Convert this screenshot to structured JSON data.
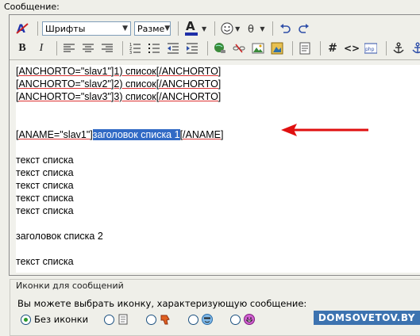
{
  "section_title": "Сообщение:",
  "toolbar": {
    "font_combo": "Шрифты",
    "size_combo": "Разме",
    "text_color_letter": "A",
    "bold_letter": "B",
    "italic_letter": "I"
  },
  "editor_lines": {
    "l1": "[ANCHORTO=\"slav1\"]1) список[/ANCHORTO]",
    "l2": "[ANCHORTO=\"slav2\"]2) список[/ANCHORTO]",
    "l3": "[ANCHORTO=\"slav3\"]3) список[/ANCHORTO]",
    "aname_open": "[ANAME=\"slav1\"]",
    "aname_selected": "заголовок списка 1",
    "aname_close": "[/ANAME]",
    "t1": "текст списка",
    "t2": "текст списка",
    "t3": "текст списка",
    "t4": "текст списка",
    "t5": "текст списка",
    "h2": "заголовок списка 2",
    "t6": "текст списка"
  },
  "icons_section": {
    "legend": "Иконки для сообщений",
    "hint": "Вы можете выбрать иконку, характеризующую сообщение:",
    "no_icon_label": "Без иконки"
  },
  "watermark": "DOMSOVETOV.BY",
  "colors": {
    "selection": "#316ac5",
    "arrow": "#e01010",
    "watermark_bg": "#3d73b0"
  }
}
